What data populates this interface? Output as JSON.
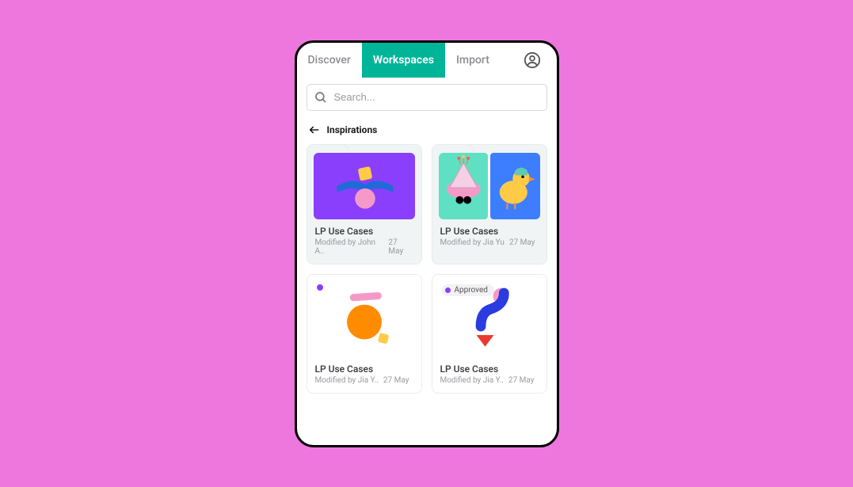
{
  "tabs": {
    "discover": "Discover",
    "workspaces": "Workspaces",
    "import": "Import"
  },
  "search": {
    "placeholder": "Search..."
  },
  "breadcrumb": {
    "label": "Inspirations"
  },
  "cards": [
    {
      "title": "LP Use Cases",
      "modified_by": "Modified by John A..",
      "date": "27 May"
    },
    {
      "title": "LP Use Cases",
      "modified_by": "Modified by Jia Yu",
      "date": "27 May"
    },
    {
      "title": "LP Use Cases",
      "modified_by": "Modified by Jia Y..",
      "date": "27 May"
    },
    {
      "title": "LP Use Cases",
      "modified_by": "Modified by Jia Y..",
      "date": "27 May",
      "badge": "Approved"
    }
  ],
  "colors": {
    "bg": "#ee77dd",
    "accent": "#00b597",
    "purple": "#8a3ffc",
    "orange": "#ff8c00",
    "pink": "#f59ac8",
    "yellow": "#ffcb47",
    "blue": "#3d7eff"
  }
}
